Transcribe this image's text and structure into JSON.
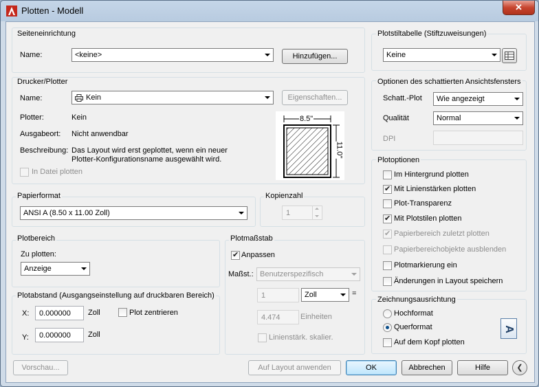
{
  "window": {
    "title": "Plotten - Modell",
    "close_label": "✕"
  },
  "page_setup": {
    "group": "Seiteneinrichtung",
    "name_label": "Name:",
    "name_value": "<keine>",
    "add_button": "Hinzufügen..."
  },
  "printer": {
    "group": "Drucker/Plotter",
    "name_label": "Name:",
    "name_value": "Kein",
    "properties_button": "Eigenschaften...",
    "plotter_label": "Plotter:",
    "plotter_value": "Kein",
    "location_label": "Ausgabeort:",
    "location_value": "Nicht anwendbar",
    "desc_label": "Beschreibung:",
    "desc_line1": "Das Layout wird erst geplottet, wenn ein neuer",
    "desc_line2": "Plotter-Konfigurationsname ausgewählt wird.",
    "plot_to_file": "In Datei plotten",
    "preview_width": "8.5\"",
    "preview_height": "11.0\""
  },
  "paper": {
    "group": "Papierformat",
    "value": "ANSI A (8.50 x 11.00 Zoll)"
  },
  "copies": {
    "group": "Kopienzahl",
    "value": "1"
  },
  "plot_area": {
    "group": "Plotbereich",
    "what_label": "Zu plotten:",
    "what_value": "Anzeige"
  },
  "plot_offset": {
    "group": "Plotabstand (Ausgangseinstellung auf druckbaren Bereich)",
    "x_label": "X:",
    "x_value": "0.000000",
    "x_unit": "Zoll",
    "y_label": "Y:",
    "y_value": "0.000000",
    "y_unit": "Zoll",
    "center": "Plot zentrieren"
  },
  "plot_scale": {
    "group": "Plotmaßstab",
    "fit": "Anpassen",
    "scale_label": "Maßst.:",
    "scale_value": "Benutzerspezifisch",
    "value1": "1",
    "unit_value": "Zoll",
    "equals": "=",
    "value2": "4.474",
    "units_label": "Einheiten",
    "lineweights": "Linienstärk. skalier."
  },
  "plot_style_table": {
    "group": "Plotstiltabelle (Stiftzuweisungen)",
    "value": "Keine"
  },
  "shaded": {
    "group": "Optionen des schattierten Ansichtsfensters",
    "shade_label": "Schatt.-Plot",
    "shade_value": "Wie angezeigt",
    "quality_label": "Qualität",
    "quality_value": "Normal",
    "dpi_label": "DPI"
  },
  "options": {
    "group": "Plotoptionen",
    "items": [
      {
        "label": "Im Hintergrund plotten"
      },
      {
        "label": "Mit Linienstärken plotten"
      },
      {
        "label": "Plot-Transparenz"
      },
      {
        "label": "Mit Plotstilen plotten"
      },
      {
        "label": "Papierbereich zuletzt plotten"
      },
      {
        "label": "Papierbereichobjekte ausblenden"
      },
      {
        "label": "Plotmarkierung ein"
      },
      {
        "label": "Änderungen in Layout speichern"
      }
    ]
  },
  "orientation": {
    "group": "Zeichnungsausrichtung",
    "portrait": "Hochformat",
    "landscape": "Querformat",
    "upside_down": "Auf dem Kopf plotten",
    "icon_letter": "A"
  },
  "buttons": {
    "preview": "Vorschau...",
    "apply": "Auf Layout anwenden",
    "ok": "OK",
    "cancel": "Abbrechen",
    "help": "Hilfe",
    "collapse": "❮"
  }
}
